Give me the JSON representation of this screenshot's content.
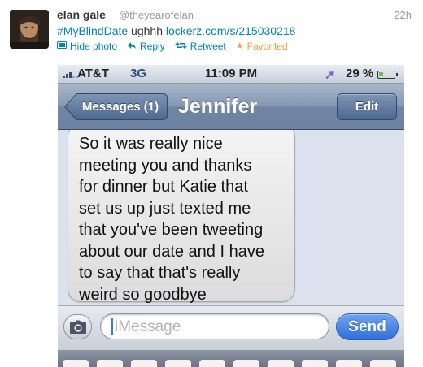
{
  "tweet": {
    "name": "elan gale",
    "handle": "@theyearofelan",
    "time": "22h",
    "hashtag": "#MyBlindDate",
    "text": " ughhh ",
    "link": "lockerz.com/s/215030218",
    "actions": [
      {
        "label": "Hide photo",
        "icon": "photo-icon"
      },
      {
        "label": "Reply",
        "icon": "reply-icon"
      },
      {
        "label": "Retweet",
        "icon": "retweet-icon"
      },
      {
        "label": "Favorited",
        "icon": "star-icon"
      }
    ],
    "colors": {
      "link": "#0084b4",
      "favorited": "#e8a23d"
    }
  },
  "phone": {
    "status": {
      "carrier": "AT&T",
      "network": "3G",
      "time": "11:09 PM",
      "battery_percent": "29 %",
      "battery_level": 0.29
    },
    "nav": {
      "back_label": "Messages (1)",
      "title": "Jennifer",
      "edit_label": "Edit"
    },
    "message": {
      "lines": [
        "So it was really nice",
        "meeting you and thanks",
        "for dinner but Katie that",
        "set us up just texted me",
        "that you've been tweeting",
        "about our date and I have",
        "to say that that's really",
        "weird so goodbye"
      ]
    },
    "composer": {
      "placeholder": "iMessage",
      "send_label": "Send"
    }
  }
}
